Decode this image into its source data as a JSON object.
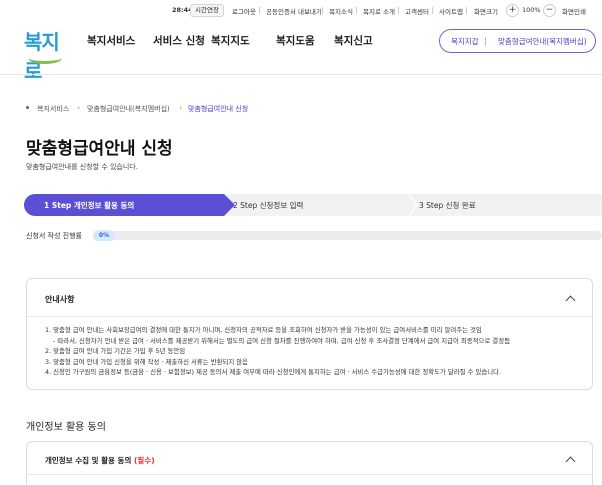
{
  "util": {
    "time": "28:44",
    "extend_label": "시간연장",
    "links": [
      "로그아웃",
      "공동인증서 내보내기",
      "복지소식",
      "복지로 소개",
      "고객센터",
      "사이트맵",
      "화면크기"
    ],
    "zoom_in": "+",
    "zoom_value": "100%",
    "zoom_out": "−",
    "reset_label": "화면인쇄"
  },
  "header": {
    "logo_text": "복지로",
    "gnb": [
      "복지서비스",
      "서비스 신청",
      "복지지도",
      "복지도움",
      "복지신고"
    ],
    "pill": {
      "left": "복지지갑",
      "right": "맞춤형급여안내(복지멤버십)"
    }
  },
  "breadcrumb": [
    "복지서비스",
    "맞춤형급여안내(복지멤버십)",
    "맞춤형급여안내 신청"
  ],
  "page": {
    "title": "맞춤형급여안내 신청",
    "subtitle": "맞춤형급여안내를 신청할 수 있습니다."
  },
  "steps": [
    {
      "label": "1 Step 개인정보 활용 동의",
      "active": true
    },
    {
      "label": "2 Step 신청정보 입력",
      "active": false
    },
    {
      "label": "3 Step 신청 완료",
      "active": false
    }
  ],
  "progress": {
    "label": "신청서 작성 진행률",
    "value_text": "0%",
    "fraction": 0.0
  },
  "notice": {
    "title": "안내사항",
    "lines": [
      "1. 맞춤형 급여 안내는 사회보장급여의 결정에 대한 통지가 아니며, 신청자의 공적자료 등을 조회하여 신청자가 받을 가능성이 있는 급여서비스를 미리 알려주는 것임",
      "  - 따라서, 신청자가 안내 받은 급여 · 서비스를 제공받기 위해서는 별도의 급여 신청 절차를 진행하여야 하며, 급여 신청 후 조사결정 단계에서 급여 지급이 최종적으로 결정됨",
      "2. 맞춤형 급여 안내 가입 기간은 가입 후 5년 동안임",
      "3. 맞춤형 급여 안내 가입 신청을 위해 작성 · 제출하신 서류는 반환되지 않음",
      "4. 신청인 가구원의 금융정보 등(금융 · 신용 · 보험정보) 제공 동의서 제출 여부에 따라 신청인에게 통지하는 급여 · 서비스 수급가능성에 대한 정확도가 달라질 수 있습니다."
    ]
  },
  "consent": {
    "section_title": "개인정보 활용 동의",
    "box_title": "개인정보 수집 및 활용 동의",
    "required": "(필수)"
  },
  "colors": {
    "accent": "#5b4fd6",
    "progress": "#4d7de6",
    "required": "#e03131"
  }
}
